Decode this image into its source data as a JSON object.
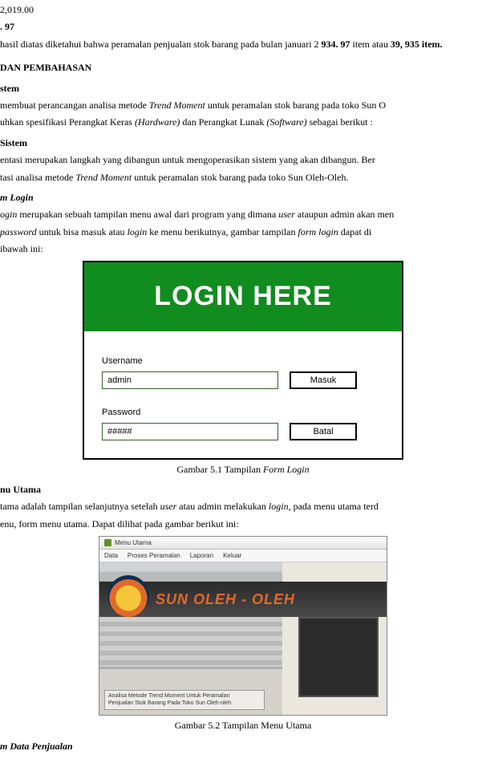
{
  "lines": {
    "l1": "2,019.00",
    "l2": ". 97",
    "l3_a": " hasil diatas diketahui bahwa peramalan penjualan stok barang pada bulan januari 2",
    "l3_b": "934. 97",
    "l3_c": " item atau ",
    "l3_d": "39, 935 item.",
    "sec1": " DAN PEMBAHASAN",
    "sub_sistem": "stem",
    "sistem_p1_a": "membuat perancangan analisa metode ",
    "sistem_p1_b": "Trend Moment",
    "sistem_p1_c": " untuk peramalan stok barang pada toko Sun O",
    "sistem_p2_a": "uhkan spesifikasi Perangkat Keras ",
    "sistem_p2_b": "(Hardware)",
    "sistem_p2_c": " dan Perangkat Lunak ",
    "sistem_p2_d": "(Software)",
    "sistem_p2_e": " sebagai berikut :",
    "sub_impl": " Sistem",
    "impl_p1": "entasi merupakan langkah yang dibangun untuk mengoperasikan sistem yang akan dibangun. Ber",
    "impl_p2_a": "tasi analisa metode ",
    "impl_p2_b": "Trend Moment",
    "impl_p2_c": " untuk peramalan stok barang pada toko Sun Oleh-Oleh.",
    "sub_formlogin": "m Login",
    "fl_p1_a": "ogin",
    "fl_p1_b": " merupakan sebuah tampilan menu awal dari program yang dimana ",
    "fl_p1_c": "user",
    "fl_p1_d": " ataupun admin akan men",
    "fl_p2_a": " password ",
    "fl_p2_b": "untuk bisa  masuk atau ",
    "fl_p2_c": "login",
    "fl_p2_d": " ke menu berikutnya, gambar tampilan ",
    "fl_p2_e": "form login",
    "fl_p2_f": " dapat di",
    "fl_p3": "ibawah ini:",
    "caption1_a": "Gambar 5.1 Tampilan ",
    "caption1_b": "Form Login",
    "sub_menuutama": "nu Utama",
    "mu_p1_a": "tama adalah tampilan selanjutnya setelah ",
    "mu_p1_b": "user",
    "mu_p1_c": " atau admin melakukan ",
    "mu_p1_d": "login,",
    "mu_p1_e": " pada menu utama terd",
    "mu_p2": "enu, form menu utama. Dapat dilihat pada gambar berikut ini:",
    "caption2": "Gambar 5.2 Tampilan Menu Utama",
    "sub_datapenj": "m  Data Penjualan"
  },
  "login": {
    "banner": "LOGIN HERE",
    "username_label": "Username",
    "username_value": "admin",
    "password_label": "Password",
    "password_value": "#####",
    "btn_masuk": "Masuk",
    "btn_batal": "Batal"
  },
  "menu": {
    "titlebar": "Menu Utama",
    "items": [
      "Data",
      "Proses Peramalan",
      "Laporan",
      "Keluar"
    ],
    "sign": "SUN OLEH - OLEH",
    "overlay_line1": "Analisa Metode Trend Moment Untuk Peramalan",
    "overlay_line2": "Penjualan Stok Barang Pada Toko Sun Oleh-oleh"
  }
}
